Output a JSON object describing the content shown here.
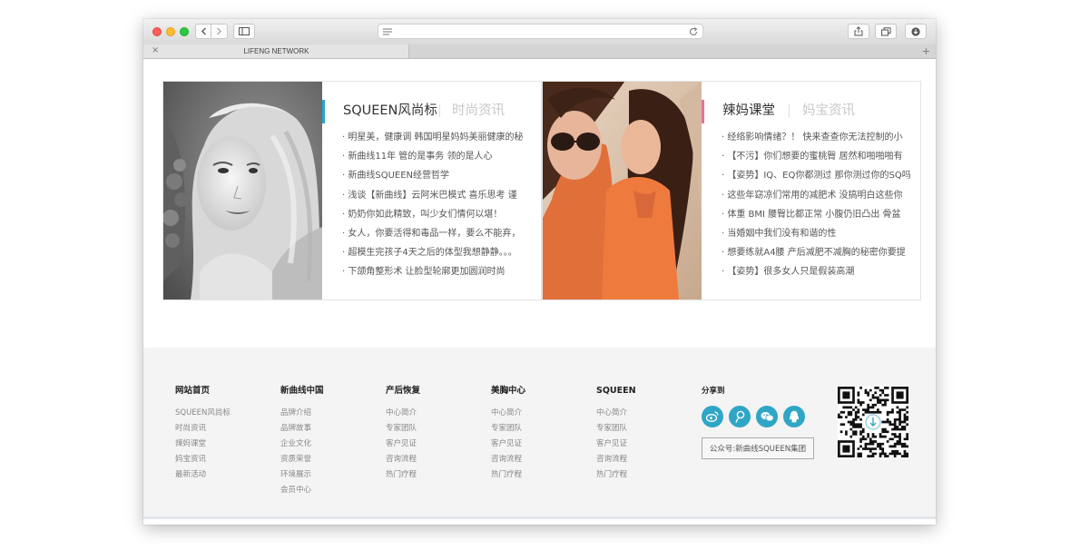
{
  "browser": {
    "tab_title": "LIFENG NETWORK",
    "tab_close": "×",
    "new_tab": "+"
  },
  "panels": [
    {
      "title": "SQUEEN风尚标",
      "subtitle": "时尚资讯",
      "accent_color": "#2aa7c8",
      "items": [
        "· 明星美，健康调 韩国明星妈妈美丽健康的秘",
        "· 新曲线11年 管的是事务 领的是人心",
        "· 新曲线SQUEEN经营哲学",
        "· 浅谈【新曲线】云阿米巴模式 喜乐思考 谨",
        "· 奶奶你如此精致，叫少女们情何以堪！",
        "· 女人，你要活得和毒品一样，要么不能弃，",
        "· 超模生完孩子4天之后的体型我想静静。。。",
        "· 下颌角整形术 让脸型轮廓更加圆润时尚"
      ]
    },
    {
      "title": "辣妈课堂",
      "subtitle": "妈宝资讯",
      "accent_color": "#e8739a",
      "items": [
        "· 经络影响情绪？！ 快来查查你无法控制的小",
        "· 【不污】你们想要的蜜桃臀 居然和啪啪啪有",
        "· 【姿势】IQ、EQ你都测过 那你测过你的SQ吗",
        "· 这些年窈凉们常用的减肥术 没搞明白这些你",
        "· 体重 BMI 腰臀比都正常 小腹仍旧凸出 骨盆",
        "· 当婚姻中我们没有和谐的性",
        "· 想要练就A4腰 产后减肥不减胸的秘密你要提",
        "· 【姿势】很多女人只是假装高潮"
      ]
    }
  ],
  "footer": {
    "columns": [
      {
        "heading": "网站首页",
        "links": [
          "SQUEEN风尚标",
          "时尚资讯",
          "辣妈课堂",
          "妈宝资讯",
          "最新活动"
        ]
      },
      {
        "heading": "新曲线中国",
        "links": [
          "品牌介绍",
          "品牌故事",
          "企业文化",
          "资质荣誉",
          "环境展示",
          "会员中心"
        ]
      },
      {
        "heading": "产后恢复",
        "links": [
          "中心简介",
          "专家团队",
          "客户见证",
          "咨询流程",
          "热门疗程"
        ]
      },
      {
        "heading": "美胸中心",
        "links": [
          "中心简介",
          "专家团队",
          "客户见证",
          "咨询流程",
          "热门疗程"
        ]
      },
      {
        "heading": "SQUEEN",
        "links": [
          "中心简介",
          "专家团队",
          "客户见证",
          "咨询流程",
          "热门疗程"
        ]
      }
    ],
    "share_label": "分享到",
    "share_icons": [
      "weibo-icon",
      "tencent-weibo-icon",
      "wechat-icon",
      "qq-icon"
    ],
    "share_color": "#2fa6c6",
    "wechat_button": "公众号:新曲线SQUEEN集团"
  }
}
